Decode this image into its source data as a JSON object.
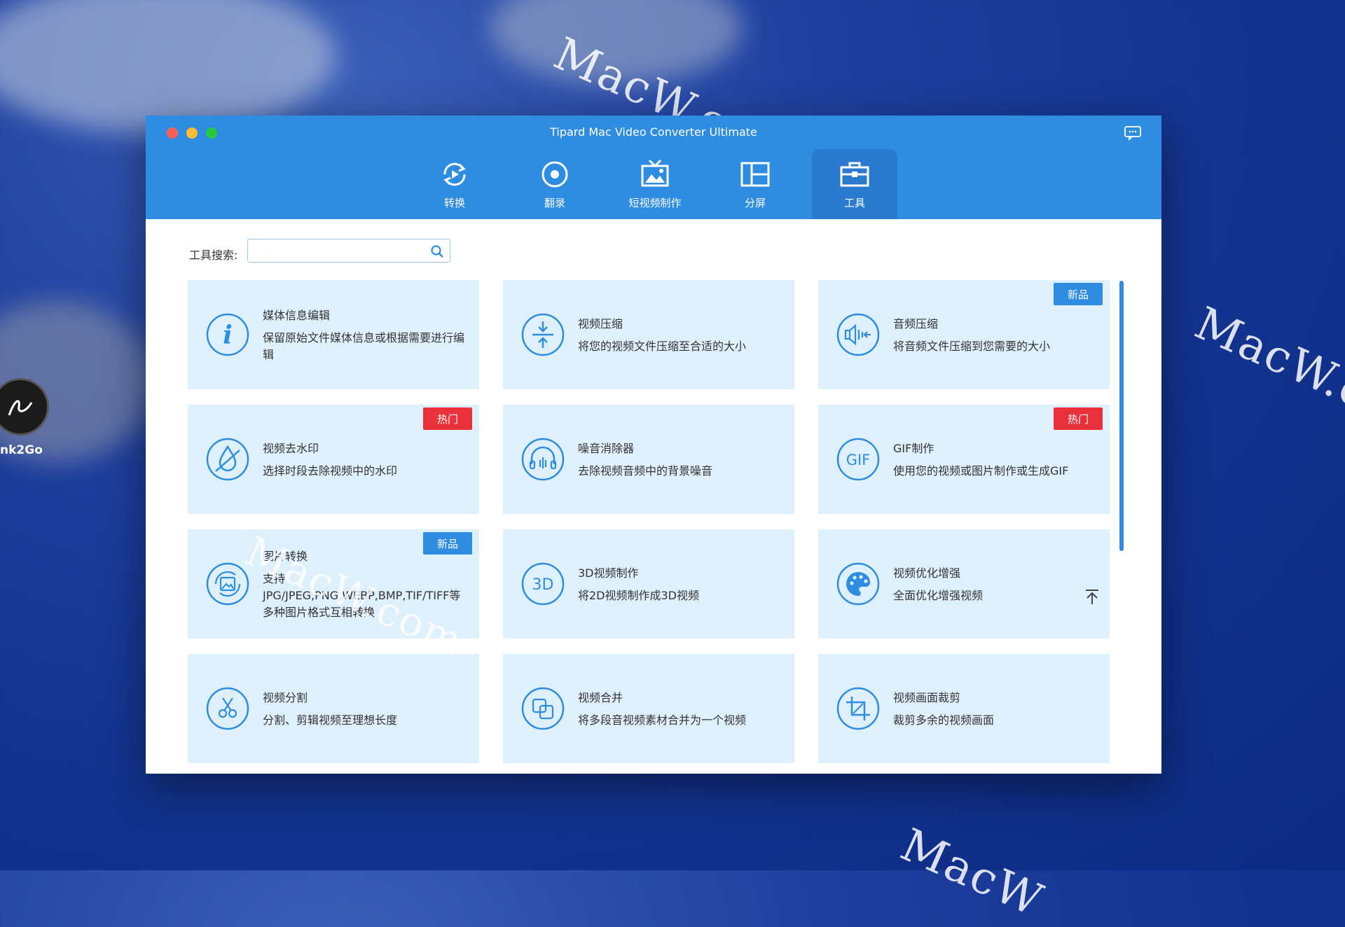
{
  "app": {
    "title": "Tipard Mac Video Converter Ultimate",
    "accent": "#2e8de0"
  },
  "desktop": {
    "icon_label": "nk2Go",
    "watermarks": [
      "MacW.com",
      "MacW.c",
      "MacW.com",
      "MacW"
    ]
  },
  "nav": [
    {
      "label": "转换",
      "icon": "convert-icon"
    },
    {
      "label": "翻录",
      "icon": "disc-icon"
    },
    {
      "label": "短视频制作",
      "icon": "mv-icon"
    },
    {
      "label": "分屏",
      "icon": "split-screen-icon"
    },
    {
      "label": "工具",
      "icon": "toolbox-icon",
      "active": true
    }
  ],
  "search": {
    "label": "工具搜索:",
    "value": "",
    "placeholder": ""
  },
  "tools": [
    {
      "title": "媒体信息编辑",
      "desc": "保留原始文件媒体信息或根据需要进行编辑",
      "icon": "info-icon",
      "badge": ""
    },
    {
      "title": "视频压缩",
      "desc": "将您的视频文件压缩至合适的大小",
      "icon": "compress-icon",
      "badge": ""
    },
    {
      "title": "音频压缩",
      "desc": "将音频文件压缩到您需要的大小",
      "icon": "audio-compress-icon",
      "badge": "新品"
    },
    {
      "title": "视频去水印",
      "desc": "选择时段去除视频中的水印",
      "icon": "watermark-remove-icon",
      "badge": "热门"
    },
    {
      "title": "噪音消除器",
      "desc": "去除视频音频中的背景噪音",
      "icon": "headphones-icon",
      "badge": ""
    },
    {
      "title": "GIF制作",
      "desc": "使用您的视频或图片制作或生成GIF",
      "icon": "gif-icon",
      "badge": "热门"
    },
    {
      "title": "图片转换",
      "desc": "支持JPG/JPEG,PNG,WEBP,BMP,TIF/TIFF等多种图片格式互相转换",
      "icon": "image-convert-icon",
      "badge": "新品"
    },
    {
      "title": "3D视频制作",
      "desc": "将2D视频制作成3D视频",
      "icon": "3d-icon",
      "badge": ""
    },
    {
      "title": "视频优化增强",
      "desc": "全面优化增强视频",
      "icon": "palette-icon",
      "badge": ""
    },
    {
      "title": "视频分割",
      "desc": "分割、剪辑视频至理想长度",
      "icon": "scissors-icon",
      "badge": ""
    },
    {
      "title": "视频合并",
      "desc": "将多段音视频素材合并为一个视频",
      "icon": "merge-icon",
      "badge": ""
    },
    {
      "title": "视频画面裁剪",
      "desc": "裁剪多余的视频画面",
      "icon": "crop-icon",
      "badge": ""
    }
  ],
  "badge_colors": {
    "新品": "#2e8de0",
    "热门": "#e8313a"
  }
}
